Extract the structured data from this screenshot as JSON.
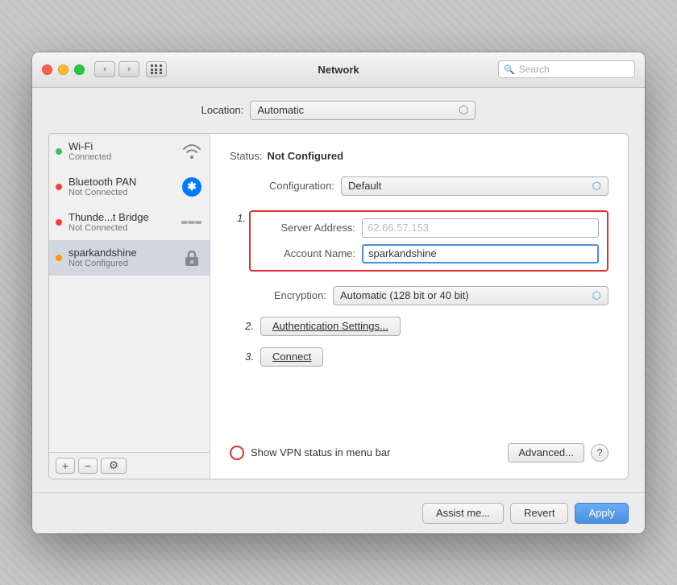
{
  "window": {
    "title": "Network",
    "search_placeholder": "Search"
  },
  "location": {
    "label": "Location:",
    "value": "Automatic"
  },
  "sidebar": {
    "items": [
      {
        "id": "wifi",
        "name": "Wi-Fi",
        "status": "Connected",
        "dot": "green",
        "icon": "wifi"
      },
      {
        "id": "bluetooth-pan",
        "name": "Bluetooth PAN",
        "status": "Not Connected",
        "dot": "red",
        "icon": "bluetooth"
      },
      {
        "id": "thunderbolt-bridge",
        "name": "Thunde...t Bridge",
        "status": "Not Connected",
        "dot": "red",
        "icon": "bridge"
      },
      {
        "id": "sparkandshine",
        "name": "sparkandshine",
        "status": "Not Configured",
        "dot": "orange",
        "icon": "lock"
      }
    ],
    "footer": {
      "add": "+",
      "remove": "−",
      "gear": "⚙"
    }
  },
  "main": {
    "status_label": "Status:",
    "status_value": "Not Configured",
    "configuration_label": "Configuration:",
    "configuration_value": "Default",
    "server_address_label": "Server Address:",
    "server_address_value": "62.66.57.153",
    "account_name_label": "Account Name:",
    "account_name_value": "sparkandshine",
    "encryption_label": "Encryption:",
    "encryption_value": "Automatic (128 bit or 40 bit)",
    "step2_label": "2.",
    "auth_settings_btn": "Authentication Settings...",
    "step3_label": "3.",
    "connect_btn": "Connect",
    "vpn_status_text": "Show VPN status in menu bar",
    "advanced_btn": "Advanced...",
    "help_btn": "?"
  },
  "footer": {
    "assist_btn": "Assist me...",
    "revert_btn": "Revert",
    "apply_btn": "Apply"
  },
  "steps": {
    "step1": "1.",
    "step2": "2.",
    "step3": "3."
  }
}
